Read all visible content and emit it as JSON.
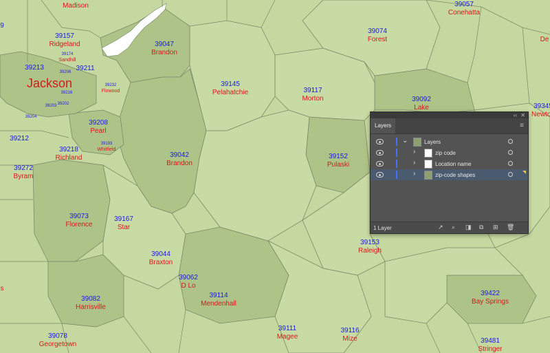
{
  "map": {
    "places": [
      {
        "zip": "",
        "town": "Madison"
      },
      {
        "zip": "39157",
        "town": "Ridgeland"
      },
      {
        "zip": "39174",
        "town": "Sandhill"
      },
      {
        "zip": "39213",
        "town": ""
      },
      {
        "zip": "39206",
        "town": ""
      },
      {
        "zip": "39211",
        "town": ""
      },
      {
        "zip": "",
        "town": "Jackson"
      },
      {
        "zip": "39232",
        "town": "Flowood"
      },
      {
        "zip": "39216",
        "town": ""
      },
      {
        "zip": "39203",
        "town": ""
      },
      {
        "zip": "39202",
        "town": ""
      },
      {
        "zip": "39204",
        "town": ""
      },
      {
        "zip": "39208",
        "town": "Pearl"
      },
      {
        "zip": "39212",
        "town": ""
      },
      {
        "zip": "39218",
        "town": "Richland"
      },
      {
        "zip": "39193",
        "town": "Whitfield"
      },
      {
        "zip": "39272",
        "town": "Byram"
      },
      {
        "zip": "39047",
        "town": "Brandon"
      },
      {
        "zip": "39145",
        "town": "Pelahatchie"
      },
      {
        "zip": "39117",
        "town": "Morton"
      },
      {
        "zip": "39074",
        "town": "Forest"
      },
      {
        "zip": "39057",
        "town": "Conehatta"
      },
      {
        "zip": "39092",
        "town": "Lake"
      },
      {
        "zip": "39345",
        "town": "Newton"
      },
      {
        "zip": "39042",
        "town": "Brandon"
      },
      {
        "zip": "39152",
        "town": "Pulaski"
      },
      {
        "zip": "39073",
        "town": "Florence"
      },
      {
        "zip": "39167",
        "town": "Star"
      },
      {
        "zip": "39044",
        "town": "Braxton"
      },
      {
        "zip": "39062",
        "town": "D Lo"
      },
      {
        "zip": "39114",
        "town": "Mendenhall"
      },
      {
        "zip": "39153",
        "town": "Raleigh"
      },
      {
        "zip": "39082",
        "town": "Harrisville"
      },
      {
        "zip": "39078",
        "town": "Georgetown"
      },
      {
        "zip": "39111",
        "town": "Magee"
      },
      {
        "zip": "39116",
        "town": "Mize"
      },
      {
        "zip": "39422",
        "town": "Bay Springs"
      },
      {
        "zip": "39481",
        "town": "Stringer"
      },
      {
        "zip": "9",
        "town": ""
      },
      {
        "zip": "",
        "town": "De"
      },
      {
        "zip": "",
        "town": "s"
      }
    ]
  },
  "layers_panel": {
    "collapse_glyph": "‹‹",
    "close_glyph": "✕",
    "tab_label": "Layers",
    "menu_glyph": "≡",
    "rows": [
      {
        "name": "Layers",
        "expanded": true
      },
      {
        "name": "zip code",
        "expanded": false
      },
      {
        "name": "Location name",
        "expanded": false
      },
      {
        "name": "zip-code shapes",
        "expanded": false,
        "selected": true
      }
    ],
    "count_label": "1 Layer",
    "colors": {
      "panel": "#535353",
      "selected": "#4a5b70",
      "layer_bar": "#4d6bff"
    }
  },
  "colors": {
    "land": "#c5d89f",
    "land_dark": "#a6bd80",
    "border": "#7a8a6a",
    "zip_text": "#1a1ae0",
    "town_text": "#d41a1a"
  }
}
